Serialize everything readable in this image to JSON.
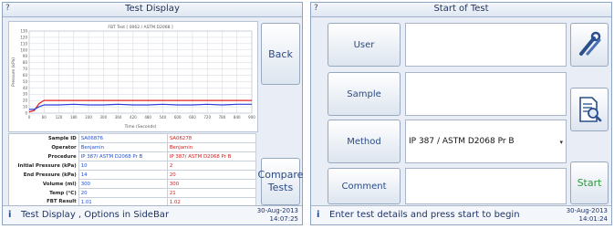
{
  "left": {
    "title": "Test Display",
    "q": "?",
    "back_label": "Back",
    "compare_label": "Compare Tests",
    "status_message": "Test Display , Options in SideBar",
    "status_date": "30-Aug-2013",
    "status_time": "14:07:25",
    "info_icon": "i",
    "chart": {
      "title": "FBT Test [ 0062 / ASTM D2068 ]",
      "xlabel": "Time (Seconds)",
      "ylabel": "Pressure (kPa)"
    },
    "table": [
      {
        "label": "Sample ID",
        "a": "SA06876",
        "b": "SA06278"
      },
      {
        "label": "Operator",
        "a": "Benjamin",
        "b": "Benjamin"
      },
      {
        "label": "Procedure",
        "a": "IP 387/ ASTM D2068 Pr B",
        "b": "IP 387/ ASTM D2068 Pr B"
      },
      {
        "label": "Initial Pressure (kPa)",
        "a": "10",
        "b": "2"
      },
      {
        "label": "End Pressure (kPa)",
        "a": "14",
        "b": "20"
      },
      {
        "label": "Volume (ml)",
        "a": "300",
        "b": "300"
      },
      {
        "label": "Temp (°C)",
        "a": "20",
        "b": "21"
      },
      {
        "label": "FBT Result",
        "a": "1.01",
        "b": "1.02"
      }
    ]
  },
  "chart_data": {
    "type": "line",
    "title": "FBT Test [ 0062 / ASTM D2068 ]",
    "xlabel": "Time (Seconds)",
    "ylabel": "Pressure (kPa)",
    "xlim": [
      0,
      900
    ],
    "ylim": [
      0,
      130
    ],
    "x_ticks": [
      "0",
      "60",
      "120",
      "180",
      "240",
      "300",
      "360",
      "420",
      "480",
      "540",
      "600",
      "660",
      "720",
      "780",
      "840",
      "900"
    ],
    "y_ticks": [
      "0",
      "10",
      "20",
      "30",
      "40",
      "50",
      "60",
      "70",
      "80",
      "90",
      "100",
      "110",
      "120",
      "130"
    ],
    "series": [
      {
        "color": "#e02020",
        "x": [
          0,
          20,
          40,
          60,
          120,
          180,
          240,
          300,
          360,
          420,
          480,
          540,
          600,
          660,
          720,
          780,
          840,
          900
        ],
        "values": [
          2,
          4,
          15,
          20,
          20,
          20,
          20,
          20,
          20,
          20,
          20,
          20,
          20,
          20,
          20,
          20,
          20,
          20
        ]
      },
      {
        "color": "#2a3fd9",
        "x": [
          0,
          20,
          40,
          60,
          120,
          180,
          240,
          300,
          360,
          420,
          480,
          540,
          600,
          660,
          720,
          780,
          840,
          900
        ],
        "values": [
          6,
          6,
          10,
          13,
          13,
          14,
          13,
          13,
          14,
          13,
          13,
          14,
          13,
          13,
          14,
          13,
          14,
          14
        ]
      }
    ],
    "grid": true
  },
  "right": {
    "title": "Start of Test",
    "q": "?",
    "user_label": "User",
    "sample_label": "Sample",
    "method_label": "Method",
    "comment_label": "Comment",
    "user_value": "",
    "sample_value": "",
    "method_value": "IP 387 / ASTM D2068 Pr B",
    "comment_value": "",
    "start_label": "Start",
    "status_message": "Enter test details and press start to begin",
    "status_date": "30-Aug-2013",
    "status_time": "14:01:24",
    "info_icon": "i",
    "icons": {
      "tools": "wrench-screwdriver-icon",
      "report": "document-search-icon"
    }
  }
}
